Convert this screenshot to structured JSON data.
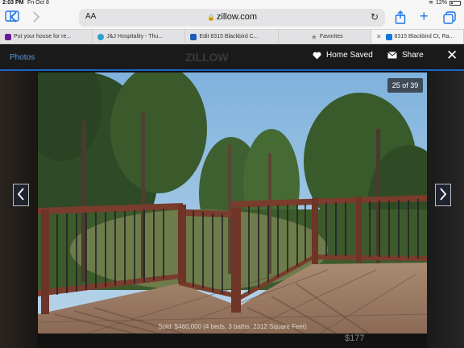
{
  "status_bar": {
    "time": "2:03 PM",
    "date": "Fri Oct 8",
    "battery": "12%"
  },
  "browser": {
    "text_size_label": "AA",
    "url": "zillow.com",
    "tabs": [
      {
        "label": "Put your house for re...",
        "color": "#6a1b9a"
      },
      {
        "label": "J&J Hospitality - Thu...",
        "color": "#2aa1c9"
      },
      {
        "label": "Edit 8315 Blackbird C...",
        "color": "#1e5bb8"
      },
      {
        "label": "Favorites",
        "color": "#8a8a8a"
      },
      {
        "label": "8315 Blackbird Ct, Ra...",
        "color": "#1277e1"
      }
    ]
  },
  "viewer": {
    "photos_label": "Photos",
    "home_saved_label": "Home Saved",
    "share_label": "Share",
    "counter": "25 of 39",
    "caption": "Sold: $460,000 (4 beds, 3 baths, 2312 Square Feet)",
    "background_price": "$177",
    "watermark": "ZILLOW"
  },
  "colors": {
    "accent": "#1f64c8",
    "photos_link": "#5a9bd8"
  }
}
